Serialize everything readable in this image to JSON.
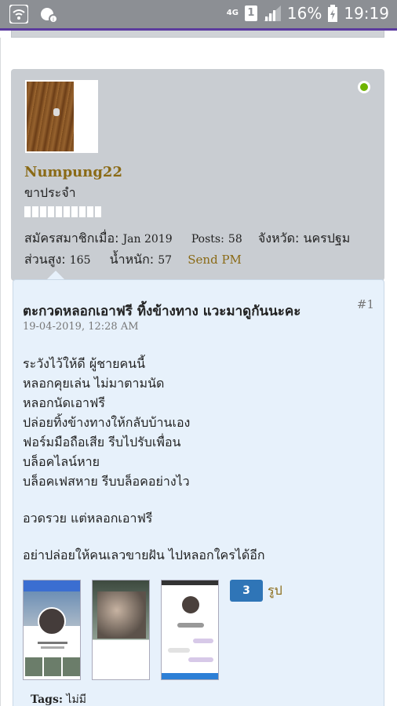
{
  "status_bar": {
    "network": "4G",
    "sim": "1",
    "battery": "16%",
    "time": "19:19",
    "icons": [
      "wifi-icon",
      "notification-icon",
      "signal-icon",
      "battery-charging-icon"
    ]
  },
  "user": {
    "name": "Numpung22",
    "title": "ขาประจำ",
    "reputation_segments": 10,
    "online": true,
    "joined_label": "สมัครสมาชิกเมื่อ:",
    "joined_value": "Jan 2019",
    "posts_label": "Posts:",
    "posts_value": "58",
    "province_label": "จังหวัด:",
    "province_value": "นครปฐม",
    "height_label": "ส่วนสูง:",
    "height_value": "165",
    "weight_label": "น้ำหนัก:",
    "weight_value": "57",
    "send_pm": "Send PM"
  },
  "post": {
    "title": "ตะกวดหลอกเอาฟรี ทิ้งข้างทาง แวะมาดูกันนะคะ",
    "number": "#1",
    "date": "19-04-2019, 12:28 AM",
    "lines": [
      "ระวังไว้ให้ดี ผู้ชายคนนี้",
      "หลอกคุยเล่น ไม่มาตามนัด",
      "หลอกนัดเอาฟรี",
      "ปล่อยทิ้งข้างทางให้กลับบ้านเอง",
      "ฟอร์มมือถือเสีย รีบไปรับเพื่อน",
      "บล็อคไลน์หาย",
      "บล็อคเฟสหาย รีบบล็อคอย่างไว"
    ],
    "line2": "อวดรวย แต่หลอกเอาฟรี",
    "line3": "อย่าปล่อยให้คนเลวขายฝัน ไปหลอกใครได้อีก",
    "image_count": "3",
    "image_count_label": "รูป",
    "tags_label": "Tags:",
    "tags_value": "ไม่มี"
  },
  "colors": {
    "status_bar": "#8c8f94",
    "user_card": "#c9cdd2",
    "post_bg": "#e7f1fb",
    "username": "#8a6a16",
    "online": "#6fb400",
    "badge": "#2f75b7"
  }
}
